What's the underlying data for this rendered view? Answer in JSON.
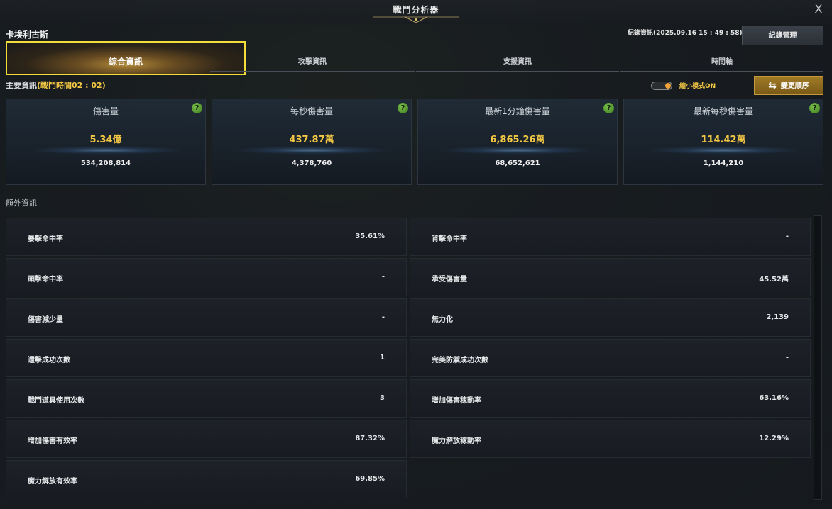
{
  "window": {
    "title": "戰鬥分析器",
    "close_label": "X"
  },
  "character": {
    "name": "卡埃利古斯"
  },
  "record": {
    "info": "紀錄資訊(2025.09.16 15 : 49 : 58)",
    "manage_label": "紀錄管理"
  },
  "tabs": [
    {
      "label": "綜合資訊",
      "active": true
    },
    {
      "label": "攻擊資訊",
      "active": false
    },
    {
      "label": "支援資訊",
      "active": false
    },
    {
      "label": "時間軸",
      "active": false
    }
  ],
  "main_info": {
    "label": "主要資訊",
    "battle_time": "(戰鬥時間02 : 02)"
  },
  "compact_mode": {
    "label": "縮小模式ON",
    "on": true
  },
  "change_order": {
    "label": "變更順序"
  },
  "stat_cards": [
    {
      "title": "傷害量",
      "big": "5.34億",
      "small": "534,208,814"
    },
    {
      "title": "每秒傷害量",
      "big": "437.87萬",
      "small": "4,378,760"
    },
    {
      "title": "最新1分鐘傷害量",
      "big": "6,865.26萬",
      "small": "68,652,621"
    },
    {
      "title": "最新每秒傷害量",
      "big": "114.42萬",
      "small": "1,144,210"
    }
  ],
  "extra_info": {
    "heading": "額外資訊",
    "left": [
      {
        "label": "暴擊命中率",
        "value": "35.61%"
      },
      {
        "label": "頭擊命中率",
        "value": "-"
      },
      {
        "label": "傷害減少量",
        "value": "-"
      },
      {
        "label": "還擊成功次數",
        "value": "1"
      },
      {
        "label": "戰鬥道具使用次數",
        "value": "3"
      },
      {
        "label": "增加傷害有效率",
        "value": "87.32%"
      },
      {
        "label": "魔力解放有效率",
        "value": "69.85%"
      }
    ],
    "right": [
      {
        "label": "背擊命中率",
        "value": "-"
      },
      {
        "label": "承受傷害量",
        "value": "45.52萬"
      },
      {
        "label": "無力化",
        "value": "2,139"
      },
      {
        "label": "完美防禦成功次數",
        "value": "-"
      },
      {
        "label": "增加傷害稼動率",
        "value": "63.16%"
      },
      {
        "label": "魔力解放稼動率",
        "value": "12.29%"
      }
    ]
  },
  "colors": {
    "accent_gold": "#f2c744",
    "tab_highlight": "#f2dd3a",
    "help_green": "#5aa032"
  },
  "icons": {
    "help": "help-icon",
    "swap": "swap-icon",
    "close": "close-icon"
  }
}
